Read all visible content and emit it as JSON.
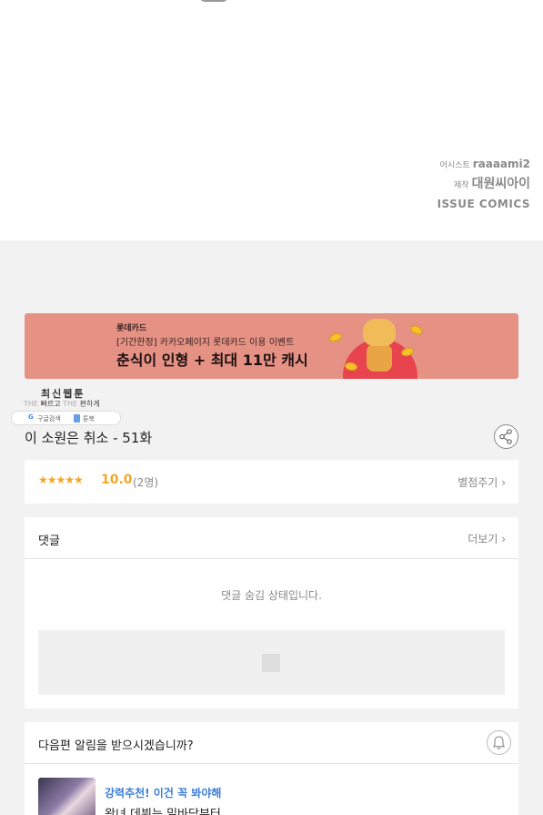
{
  "credits": {
    "assistant_label": "어시스트",
    "assistant_name": "raaaami2",
    "producer_label": "제작",
    "producer_name": "대원씨아이",
    "publisher": "ISSUE COMICS"
  },
  "banner": {
    "brand": "롯데카드",
    "subtitle": "[기간한정] 카카오페이지 롯데카드 이용 이벤트",
    "headline": "춘식이 인형 + 최대 11만 캐시",
    "colors": {
      "background": "#e59285",
      "circle": "#e8444e"
    }
  },
  "floating_badge": {
    "title": "최신웹툰",
    "subtitle_prefix": "THE",
    "subtitle_fast": "빠르고",
    "subtitle_mid": "THE",
    "subtitle_easy": "편하게",
    "google_icon": "G",
    "google_label": "구글검색",
    "toonbook_icon": "toonbook-icon",
    "toonbook_label": "툰북"
  },
  "episode": {
    "title": "이 소원은 취소 - 51화",
    "share_icon": "share-icon"
  },
  "rating": {
    "stars": "★★★★★",
    "score": "10.0",
    "count": "(2명)",
    "rate_link": "별점주기",
    "accent_color": "#f5a623"
  },
  "comments": {
    "title": "댓글",
    "more_link": "더보기",
    "hidden_message": "댓글 숨김 상태입니다."
  },
  "notification": {
    "question": "다음편 알림을 받으시겠습니까?",
    "bell_icon": "bell-icon",
    "recommendation": {
      "tag": "강력추천! 이건 꼭 봐야해",
      "title": "왕녀 데뷔는 밑바닥부터"
    }
  }
}
